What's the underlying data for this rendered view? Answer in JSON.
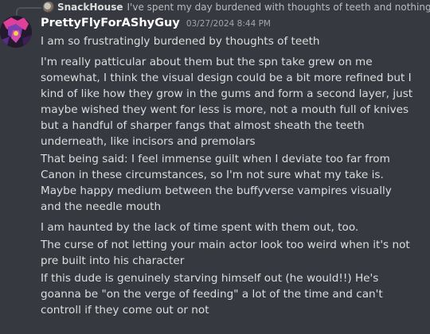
{
  "reply": {
    "avatar_icon": "snackhouse-avatar",
    "username": "SnackHouse",
    "preview": "I've spent my day burdened with thoughts of teeth and nothing else"
  },
  "message": {
    "avatar_icon": "prettyfly-avatar",
    "username": "PrettyFlyForAShyGuy",
    "timestamp": "03/27/2024 8:44 PM",
    "lines": [
      "I am so frustratingly burdened by thoughts of teeth",
      "I'm really patticular about them but the spn take grew on me somewhat, I think the visual design could be a bit more refined but I kind of like how they grow in the gums and form a second layer, just maybe wished they went for less is more, not a mouth full of knives but a handful of sharper fangs that almost sheath the teeth underneath, like incisors and premolars",
      "That being said: I feel immense guilt when I deviate too far from Canon in these circumstances, so I'm not sure what my take is. Maybe happy medium between the buffyverse vampires visually and the needle mouth",
      "I am haunted by the lack of time spent with them out, too.",
      "The curse of not letting your main actor look too weird when it's not pre built into his character",
      "If this dude is genuinely starving himself out (he would!!) He's goanna be \"on the verge of feeding\" a lot of the time and can't controll if they come out or not"
    ]
  },
  "colors": {
    "background": "#36393f",
    "username": "#ffffff",
    "text": "#dcddde",
    "timestamp": "#a3a6aa"
  }
}
